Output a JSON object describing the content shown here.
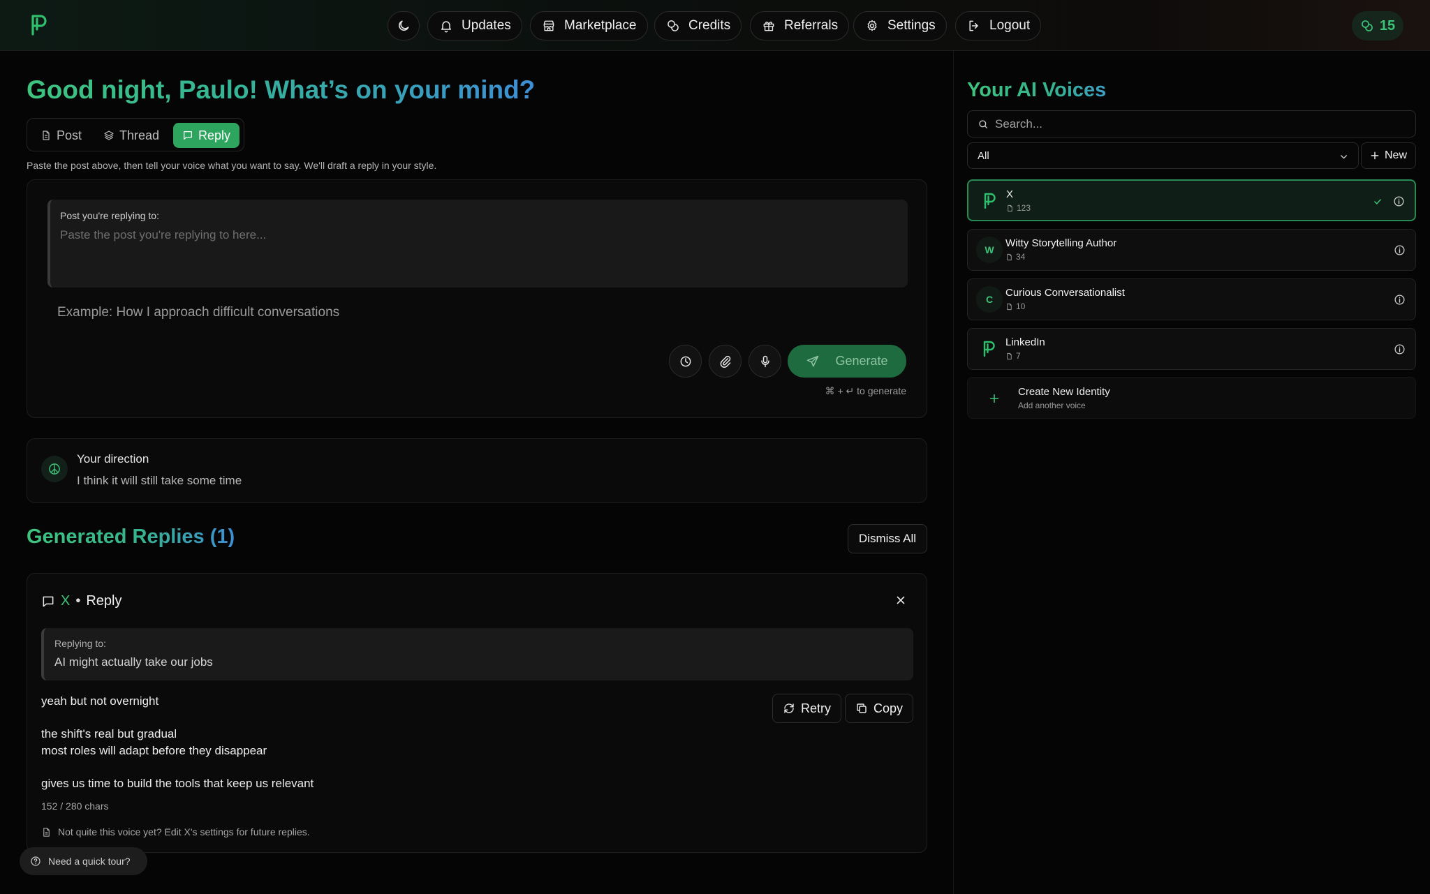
{
  "brand": {
    "accent": "#3cc479",
    "accent_button": "#2ea55e"
  },
  "nav": {
    "theme_icon": "moon-icon",
    "items": [
      {
        "label": "Updates",
        "icon": "bell-icon"
      },
      {
        "label": "Marketplace",
        "icon": "store-icon"
      },
      {
        "label": "Credits",
        "icon": "coins-icon"
      },
      {
        "label": "Referrals",
        "icon": "gift-icon"
      },
      {
        "label": "Settings",
        "icon": "gear-icon"
      },
      {
        "label": "Logout",
        "icon": "logout-icon"
      }
    ],
    "credits_count": "15"
  },
  "main": {
    "greeting": "Good night, Paulo! What’s on your mind?",
    "modes": [
      {
        "label": "Post",
        "icon": "document-icon"
      },
      {
        "label": "Thread",
        "icon": "layers-icon"
      },
      {
        "label": "Reply",
        "icon": "message-icon",
        "active": true
      }
    ],
    "hint": "Paste the post above, then tell your voice what you want to say. We'll draft a reply in your style.",
    "compose": {
      "reply_label": "Post you're replying to:",
      "reply_placeholder": "Paste the post you're replying to here...",
      "prompt_placeholder": "Example: How I approach difficult conversations",
      "generate_label": "Generate",
      "shortcut_hint": "⌘ + ↵ to generate"
    },
    "direction": {
      "title": "Your direction",
      "text": "I think it will still take some time"
    },
    "generated": {
      "title": "Generated Replies (1)",
      "dismiss_label": "Dismiss All",
      "reply": {
        "voice": "X",
        "dot": "•",
        "type": "Reply",
        "replying_label": "Replying to:",
        "replying_text": "AI might actually take our jobs",
        "lines": [
          "yeah but not overnight",
          "the shift's real but gradual",
          "most roles will adapt before they disappear",
          "gives us time to build the tools that keep us relevant"
        ],
        "retry_label": "Retry",
        "copy_label": "Copy",
        "char_count": "152 / 280 chars",
        "voice_note": "Not quite this voice yet? Edit X's settings for future replies."
      }
    },
    "tour_label": "Need a quick tour?"
  },
  "sidebar": {
    "title": "Your AI Voices",
    "search_placeholder": "Search...",
    "filter_value": "All",
    "new_label": "New",
    "voices": [
      {
        "name": "X",
        "count": "123",
        "avatar": "logo",
        "selected": true
      },
      {
        "name": "Witty Storytelling Author",
        "count": "34",
        "avatar": "W"
      },
      {
        "name": "Curious Conversationalist",
        "count": "10",
        "avatar": "C"
      },
      {
        "name": "LinkedIn",
        "count": "7",
        "avatar": "logo"
      }
    ],
    "create_title": "Create New Identity",
    "create_sub": "Add another voice"
  }
}
